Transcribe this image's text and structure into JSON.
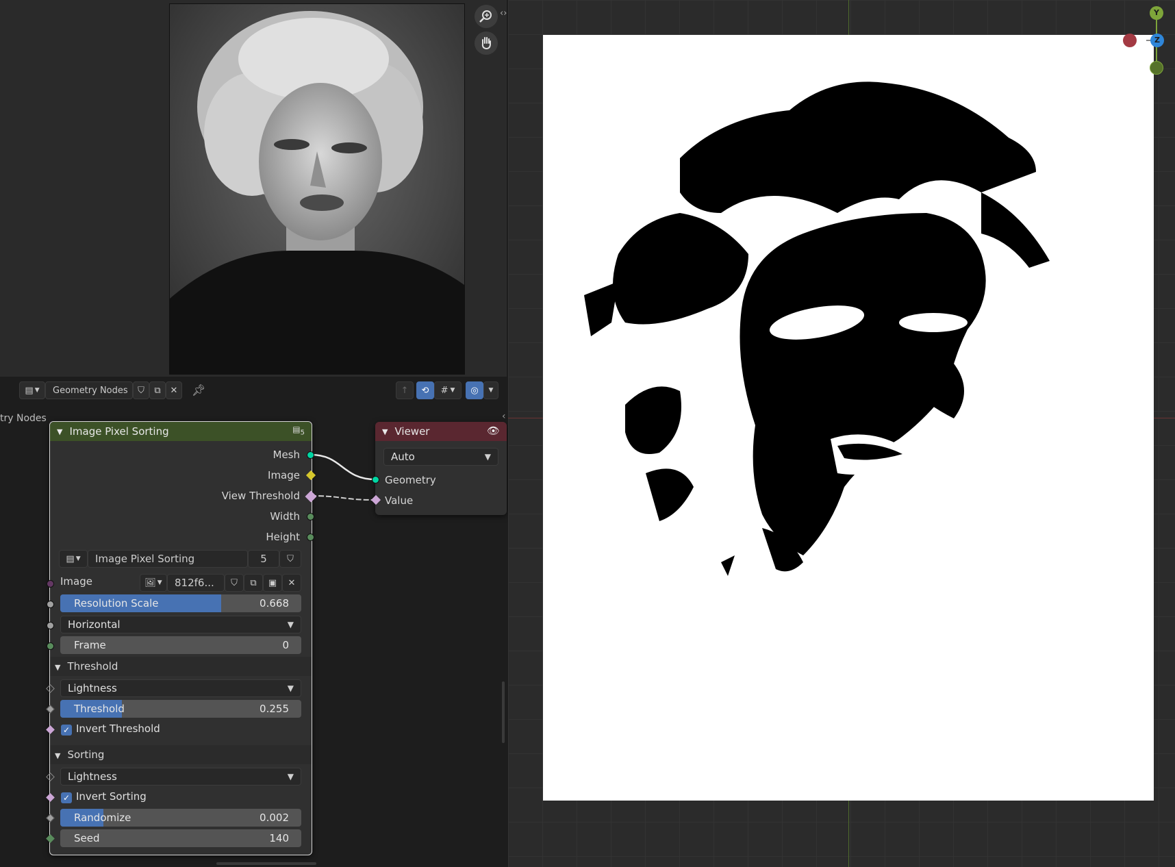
{
  "node_editor": {
    "editor_type": "Geometry Nodes",
    "breadcrumb": "try Nodes"
  },
  "node_pixel_sort": {
    "title": "Image Pixel Sorting",
    "user_count": "5",
    "outputs": [
      "Mesh",
      "Image",
      "View Threshold",
      "Width",
      "Height"
    ],
    "group_name": "Image Pixel Sorting",
    "group_users": "5",
    "image_label": "Image",
    "image_name": "812f6...",
    "resolution_scale": {
      "label": "Resolution Scale",
      "value": "0.668",
      "fraction": 0.668
    },
    "direction": "Horizontal",
    "frame": {
      "label": "Frame",
      "value": "0"
    },
    "threshold_panel": {
      "title": "Threshold",
      "mode": "Lightness",
      "threshold": {
        "label": "Threshold",
        "value": "0.255",
        "fraction": 0.255
      },
      "invert_label": "Invert Threshold",
      "invert": true
    },
    "sorting_panel": {
      "title": "Sorting",
      "mode": "Lightness",
      "invert_label": "Invert Sorting",
      "invert": true,
      "randomize": {
        "label": "Randomize",
        "value": "0.002",
        "fraction": 0.002
      },
      "seed": {
        "label": "Seed",
        "value": "140"
      }
    }
  },
  "node_viewer": {
    "title": "Viewer",
    "domain": "Auto",
    "inputs": [
      "Geometry",
      "Value"
    ]
  },
  "gizmo": {
    "y": "Y",
    "z": "Z"
  },
  "colors": {
    "geometry_socket": "#00d6a3",
    "image_socket": "#d6c72c",
    "float_socket": "#a1a1a1",
    "int_socket": "#598c5c",
    "bool_socket": "#cca6d6",
    "node_header_green": "#3c5127",
    "node_header_viewer": "#5a2730",
    "accent": "#4772b3"
  }
}
